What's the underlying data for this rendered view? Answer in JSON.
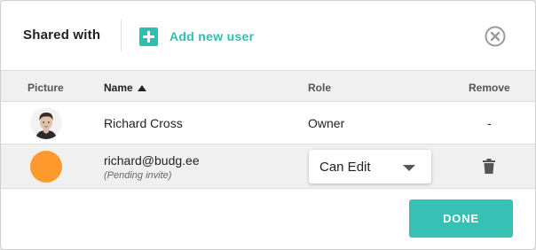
{
  "header": {
    "title": "Shared with",
    "add_user_label": "Add new user"
  },
  "table": {
    "columns": {
      "picture": "Picture",
      "name": "Name",
      "role": "Role",
      "remove": "Remove"
    },
    "sort": {
      "column": "name",
      "direction": "ascending"
    },
    "rows": [
      {
        "name": "Richard Cross",
        "role": "Owner",
        "remove": "-",
        "avatar": "user-photo"
      },
      {
        "name": "richard@budg.ee",
        "status": "(Pending invite)",
        "role": "Can Edit",
        "avatar_color": "#ff9a2e"
      }
    ]
  },
  "footer": {
    "done_label": "DONE"
  },
  "colors": {
    "accent": "#2fbfb0",
    "done_button": "#36c1b4",
    "header_row": "#f0f0f0"
  },
  "icons": {
    "add": "plus-square-icon",
    "close": "close-circle-icon",
    "sort": "sort-ascending-icon",
    "dropdown": "caret-down-icon",
    "remove": "trash-icon"
  }
}
